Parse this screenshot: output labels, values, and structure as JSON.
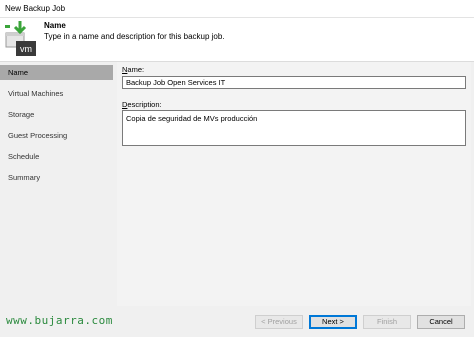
{
  "window": {
    "title": "New Backup Job"
  },
  "header": {
    "title": "Name",
    "description": "Type in a name and description for this backup job.",
    "icon": "backup-job-vm-icon",
    "icon_text": "vm"
  },
  "sidebar": {
    "items": [
      {
        "label": "Name",
        "active": true
      },
      {
        "label": "Virtual Machines",
        "active": false
      },
      {
        "label": "Storage",
        "active": false
      },
      {
        "label": "Guest Processing",
        "active": false
      },
      {
        "label": "Schedule",
        "active": false
      },
      {
        "label": "Summary",
        "active": false
      }
    ]
  },
  "form": {
    "name_label_accel": "N",
    "name_label_rest": "ame:",
    "name_value": "Backup Job Open Services IT",
    "description_label_accel": "D",
    "description_label_rest": "escription:",
    "description_value": "Copia de seguridad de MVs producción"
  },
  "footer": {
    "watermark": "www.bujarra.com",
    "previous_label": "< Previous",
    "next_label": "Next >",
    "finish_label": "Finish",
    "cancel_label": "Cancel"
  },
  "colors": {
    "accent": "#0078d7",
    "sidebar_active": "#a9a9a9",
    "icon_green": "#3aa43a",
    "watermark": "#2b8a3e"
  }
}
